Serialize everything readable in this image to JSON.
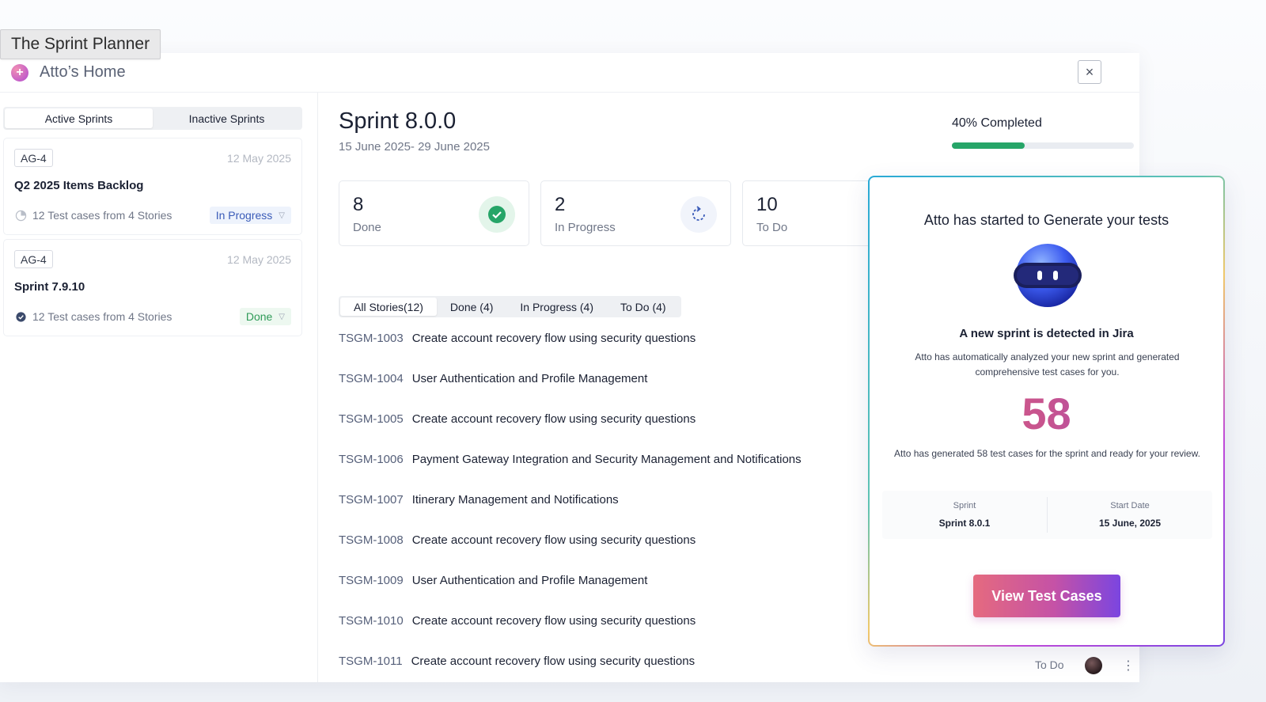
{
  "tooltip": "The Sprint Planner",
  "window": {
    "title": "Atto’s Home",
    "close_label": "×"
  },
  "sidebar": {
    "tabs": [
      {
        "label": "Active Sprints",
        "active": true
      },
      {
        "label": "Inactive Sprints",
        "active": false
      }
    ],
    "cards": [
      {
        "key": "AG-4",
        "date": "12 May 2025",
        "name": "Q2 2025 Items Backlog",
        "summary": "12 Test cases from 4 Stories",
        "status": "In Progress"
      },
      {
        "key": "AG-4",
        "date": "12 May 2025",
        "name": "Sprint 7.9.10",
        "summary": "12 Test cases from 4 Stories",
        "status": "Done"
      }
    ]
  },
  "main": {
    "title": "Sprint 8.0.0",
    "dates": "15 June 2025- 29 June 2025",
    "progress": {
      "label": "40% Completed",
      "percent": 40,
      "color": "#26a568"
    },
    "stats": [
      {
        "value": "8",
        "label": "Done",
        "icon": "check-circle-icon"
      },
      {
        "value": "2",
        "label": "In Progress",
        "icon": "refresh-icon"
      },
      {
        "value": "10",
        "label": "To Do",
        "icon": ""
      }
    ],
    "tabs": [
      {
        "label": "All Stories(12)",
        "active": true
      },
      {
        "label": "Done (4)",
        "active": false
      },
      {
        "label": "In Progress (4)",
        "active": false
      },
      {
        "label": "To Do (4)",
        "active": false
      }
    ],
    "stories": [
      {
        "key": "TSGM-1003",
        "title": "Create account recovery flow using security questions"
      },
      {
        "key": "TSGM-1004",
        "title": "User Authentication and Profile Management"
      },
      {
        "key": "TSGM-1005",
        "title": "Create account recovery flow using security questions"
      },
      {
        "key": "TSGM-1006",
        "title": "Payment Gateway Integration and Security Management and Notifications"
      },
      {
        "key": "TSGM-1007",
        "title": "Itinerary Management and Notifications"
      },
      {
        "key": "TSGM-1008",
        "title": "Create account recovery flow using security questions"
      },
      {
        "key": "TSGM-1009",
        "title": "User Authentication and Profile Management"
      },
      {
        "key": "TSGM-1010",
        "title": "Create account recovery flow using security questions"
      },
      {
        "key": "TSGM-1011",
        "title": "Create account recovery flow using security questions"
      }
    ],
    "last_row_status": "To Do",
    "last_row_menu": "⋮"
  },
  "popup": {
    "heading": "Atto has started to Generate your tests",
    "subheading": "A new sprint is detected in Jira",
    "description": "Atto has automatically analyzed your new sprint and generated comprehensive test cases for you.",
    "count": "58",
    "count_description": "Atto has generated 58 test cases for the sprint and ready for your review.",
    "info": {
      "sprint_label": "Sprint",
      "sprint_value": "Sprint 8.0.1",
      "start_label": "Start Date",
      "start_value": "15 June, 2025"
    },
    "button_label": "View Test Cases"
  }
}
